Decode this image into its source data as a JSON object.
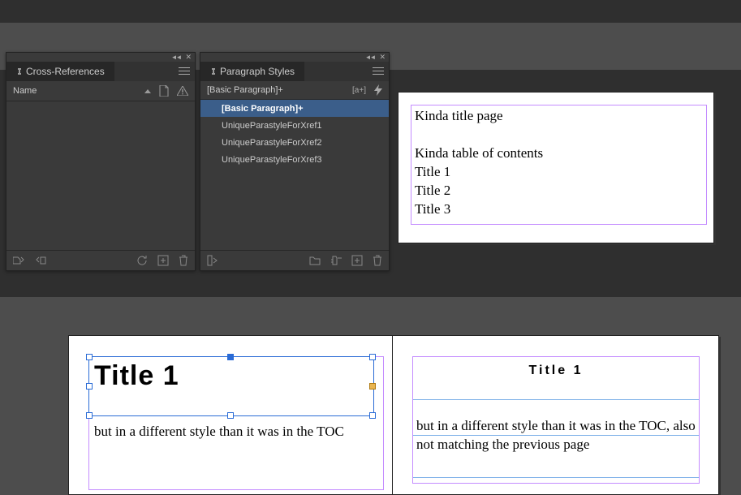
{
  "crossref": {
    "tab": "Cross-References",
    "name_header": "Name"
  },
  "parastyles": {
    "tab": "Paragraph Styles",
    "applied": "[Basic Paragraph]+",
    "items": [
      "[Basic Paragraph]+",
      "UniqueParastyleForXref1",
      "UniqueParastyleForXref2",
      "UniqueParastyleForXref3"
    ]
  },
  "doc1": {
    "l1": "Kinda title page",
    "l2": "Kinda table of contents",
    "l3": "Title 1",
    "l4": "Title 2",
    "l5": "Title 3"
  },
  "doc2": {
    "title": "Title 1",
    "body": "but in a different style than it was in the TOC"
  },
  "doc3": {
    "title": "Title  1",
    "body": "but in a different style than it was in the TOC, also not matching the previous page"
  }
}
